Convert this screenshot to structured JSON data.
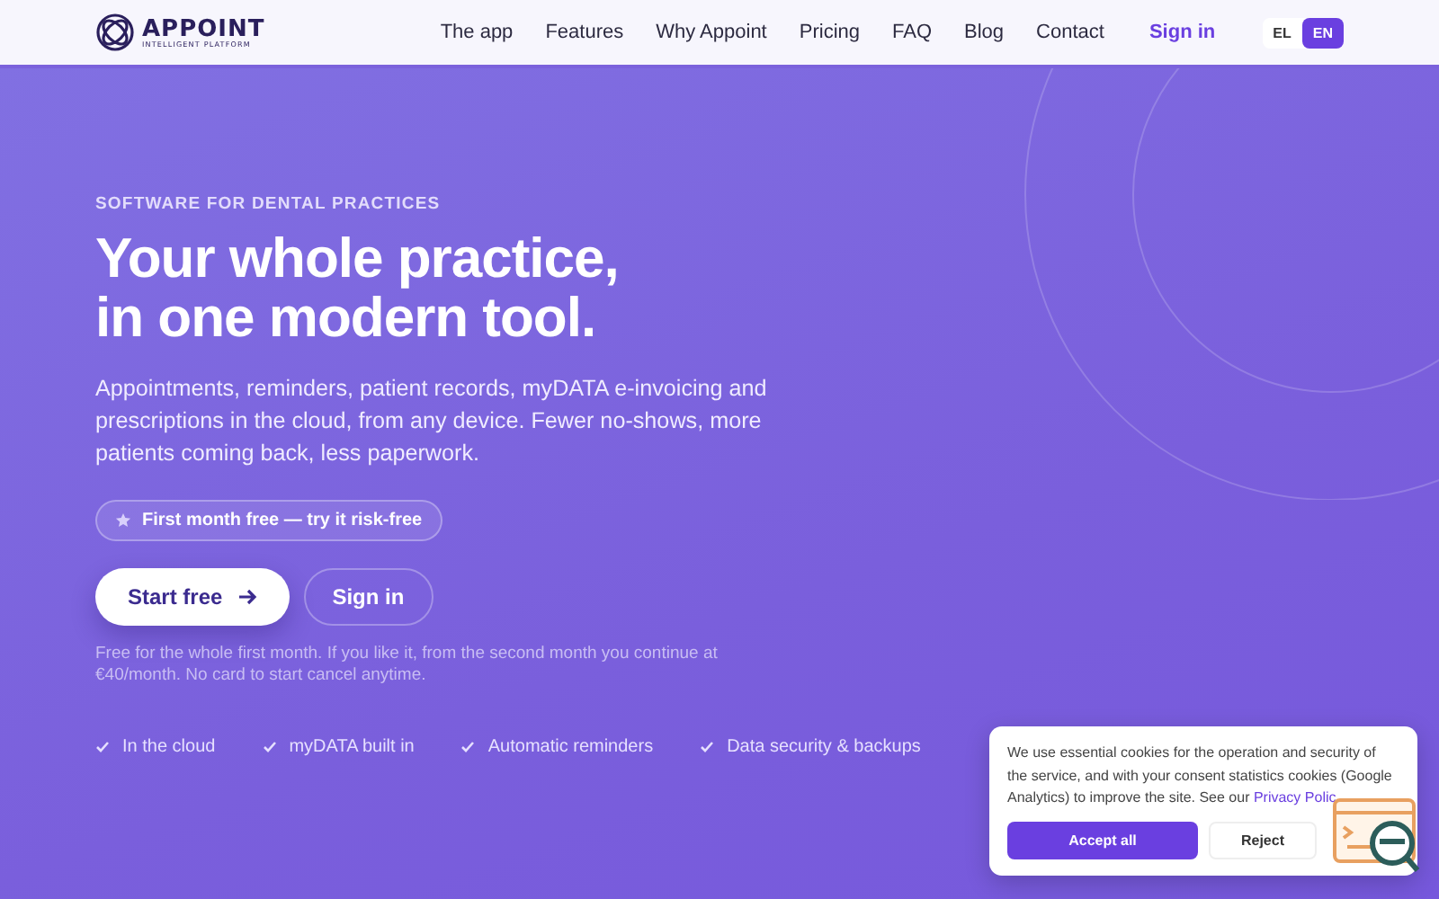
{
  "brand": {
    "name": "APPOINT",
    "tagline": "INTELLIGENT PLATFORM"
  },
  "nav": [
    {
      "label": "The app"
    },
    {
      "label": "Features"
    },
    {
      "label": "Why Appoint"
    },
    {
      "label": "Pricing"
    },
    {
      "label": "FAQ"
    },
    {
      "label": "Blog"
    },
    {
      "label": "Contact"
    }
  ],
  "sign_in": "Sign in",
  "languages": [
    {
      "label": "EL",
      "selected": false
    },
    {
      "label": "EN",
      "selected": true
    }
  ],
  "hero": {
    "eyebrow": "SOFTWARE FOR DENTAL PRACTICES",
    "title_lines": [
      "Your whole practice,",
      "in one modern tool."
    ],
    "description": "Appointments, reminders, patient records, myDATA e-invoicing and prescriptions in the cloud, from any device. Fewer no-shows, more patients coming back, less paperwork.",
    "badge": "First month free — try it risk-free",
    "primary_button": "Start free",
    "secondary_button": "Sign in",
    "note": "Free for the whole first month. If you like it, from the second month you continue at €40/month. No card to start   cancel anytime.",
    "features": [
      "In the cloud",
      "myDATA built in",
      "Automatic reminders",
      "Data security & backups"
    ]
  },
  "cookie": {
    "text": "We use essential cookies for the operation and security of the service, and with your consent statistics cookies (Google Analytics) to improve the site. See our",
    "link": "Privacy Polic",
    "accept": "Accept all",
    "reject": "Reject"
  }
}
